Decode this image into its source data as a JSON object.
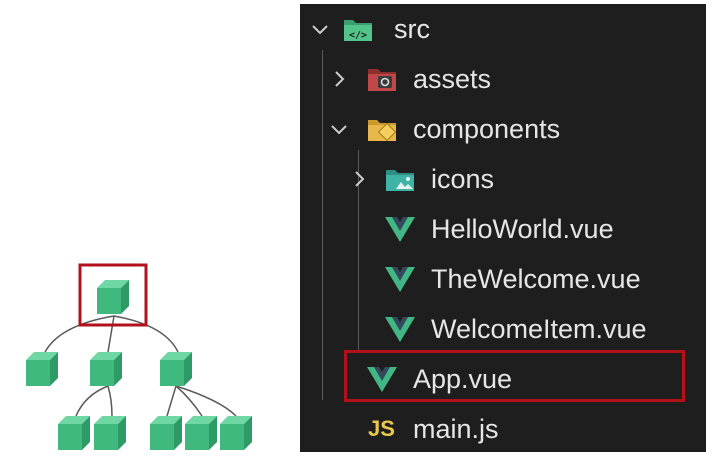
{
  "explorer": {
    "items": [
      {
        "label": "src",
        "icon": "folder-src-icon",
        "expanded": true
      },
      {
        "label": "assets",
        "icon": "folder-assets-icon",
        "expanded": false
      },
      {
        "label": "components",
        "icon": "folder-components-icon",
        "expanded": true
      },
      {
        "label": "icons",
        "icon": "folder-icons-icon",
        "expanded": false
      },
      {
        "label": "HelloWorld.vue",
        "icon": "vue-file-icon"
      },
      {
        "label": "TheWelcome.vue",
        "icon": "vue-file-icon"
      },
      {
        "label": "WelcomeItem.vue",
        "icon": "vue-file-icon"
      },
      {
        "label": "App.vue",
        "icon": "vue-file-icon",
        "highlighted": true
      },
      {
        "label": "main.js",
        "icon": "js-file-icon"
      }
    ],
    "js_badge": "JS"
  },
  "colors": {
    "panel_bg": "#1e1e1e",
    "text": "#e6e6e6",
    "highlight": "#b3101c",
    "vue_green": "#41b883",
    "vue_dark": "#34495e",
    "cube": "#3fb97e",
    "js_yellow": "#e9c84a"
  }
}
